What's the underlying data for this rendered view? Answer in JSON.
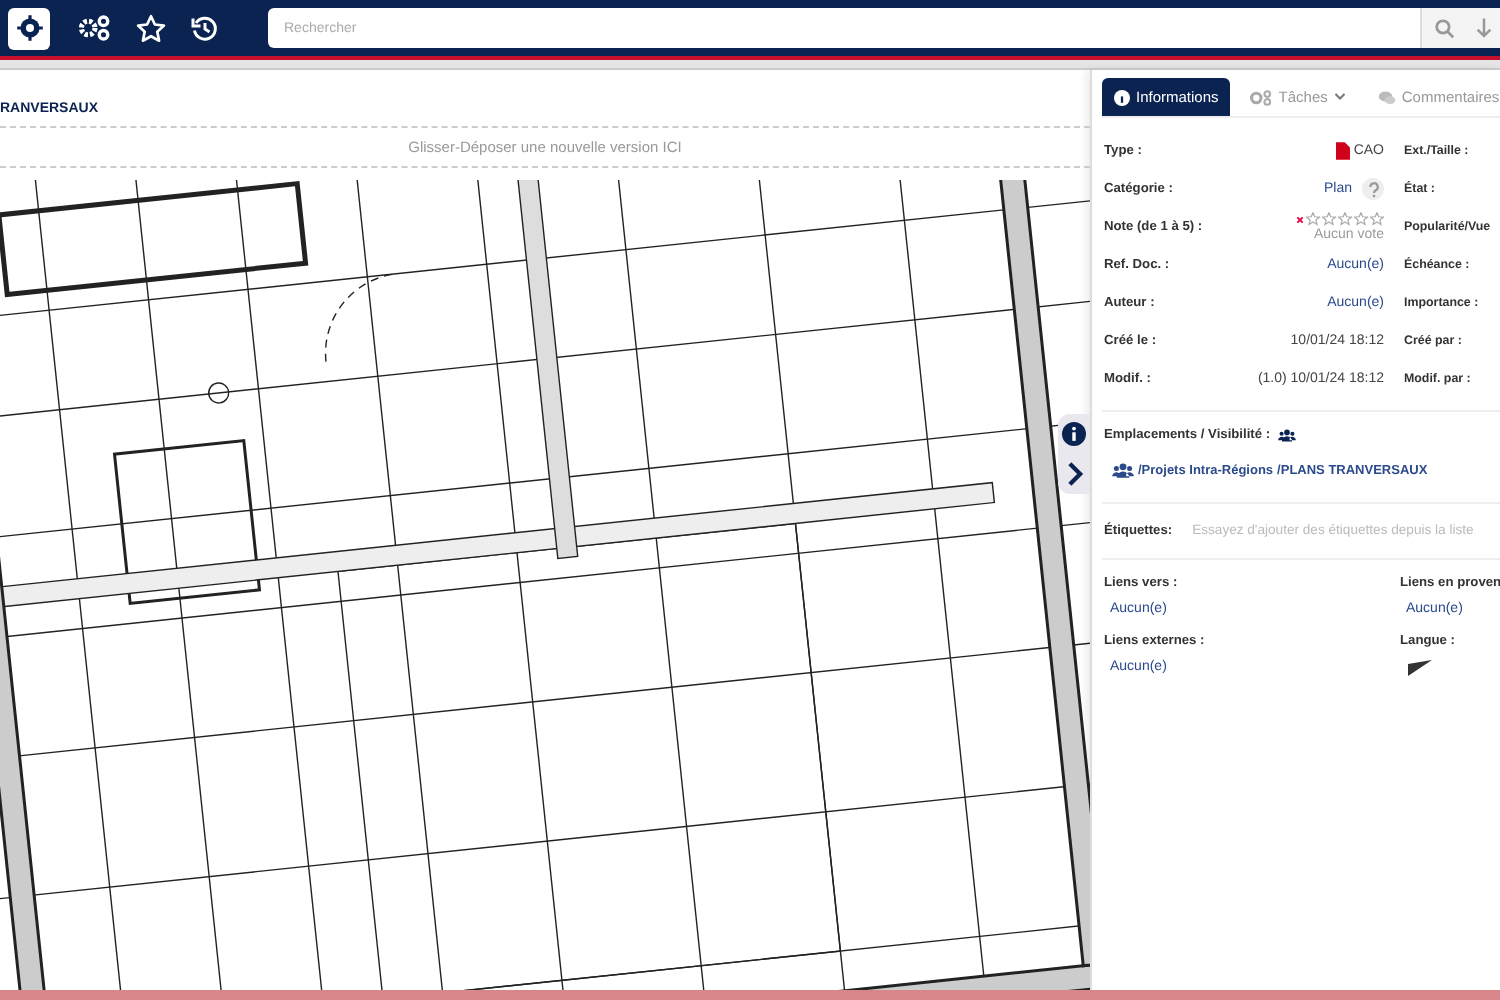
{
  "topbar": {
    "search": {
      "placeholder": "Rechercher"
    }
  },
  "breadcrumb": "RANVERSAUX",
  "dropzone": "Glisser-Déposer une nouvelle version ICI",
  "tabs": [
    {
      "label": "Informations",
      "selected": true,
      "kind": "info"
    },
    {
      "label": "Tâches",
      "selected": false,
      "kind": "tasks"
    },
    {
      "label": "Commentaires",
      "selected": false,
      "kind": "comments"
    }
  ],
  "fields": [
    {
      "label": "Type :",
      "kind": "file-type",
      "value": "CAO"
    },
    {
      "label": "Catégorie :",
      "kind": "category",
      "value": "Plan"
    },
    {
      "label": "Note (de 1 à 5) :",
      "kind": "rating",
      "stars": 0,
      "value": "Aucun vote"
    },
    {
      "label": "Ref. Doc. :",
      "kind": "link",
      "value": "Aucun(e)"
    },
    {
      "label": "Auteur :",
      "kind": "link",
      "value": "Aucun(e)"
    },
    {
      "label": "Créé le :",
      "kind": "text",
      "value": "10/01/24 18:12"
    },
    {
      "label": "Modif. :",
      "kind": "text",
      "value": "(1.0) 10/01/24 18:12"
    }
  ],
  "fields_right": [
    "Ext./Taille :",
    "État :",
    "Popularité/Vue",
    "Échéance :",
    "Importance :",
    "Créé par :",
    "Modif. par :"
  ],
  "locations": {
    "label": "Emplacements / Visibilité :",
    "path": [
      "/Projets Intra-Régions",
      "/PLANS TRANVERSAUX"
    ]
  },
  "tags": {
    "label": "Étiquettes:",
    "placeholder": "Essayez d'ajouter des étiquettes depuis la liste"
  },
  "links": [
    {
      "label": "Liens vers :",
      "kind": "links",
      "value": "Aucun(e)"
    },
    {
      "label": "Liens en proven",
      "kind": "links",
      "value": "Aucun(e)"
    },
    {
      "label": "Liens externes :",
      "kind": "links",
      "value": "Aucun(e)"
    },
    {
      "label": "Langue :",
      "kind": "language"
    }
  ]
}
